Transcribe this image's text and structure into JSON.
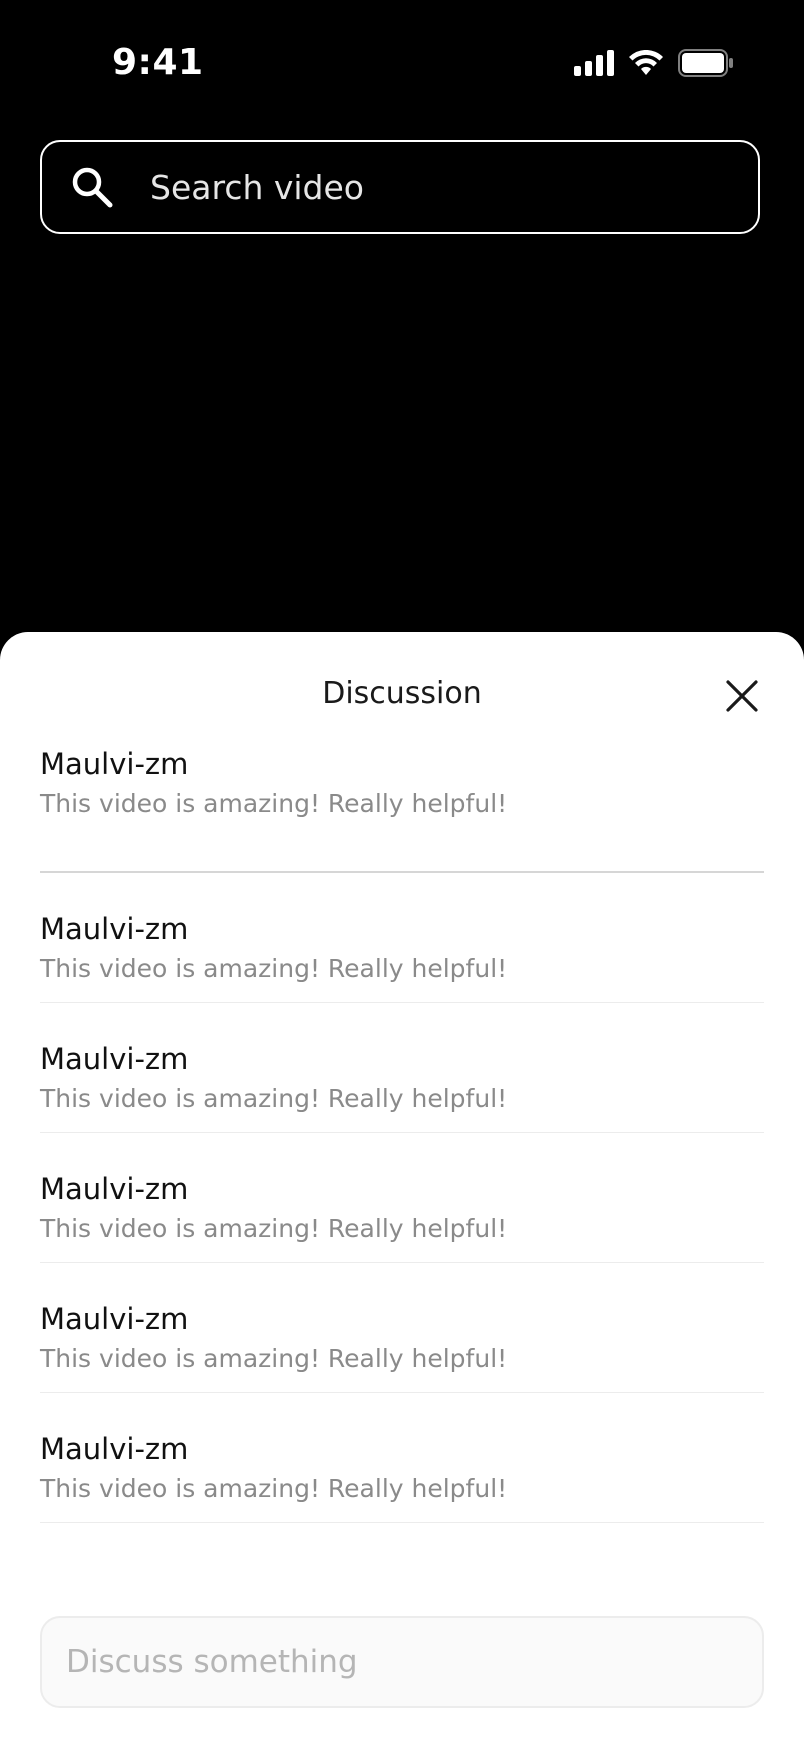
{
  "status_bar": {
    "time": "9:41",
    "icons": [
      "signal-icon",
      "wifi-icon",
      "battery-icon"
    ]
  },
  "search": {
    "placeholder": "Search video",
    "icon": "search-icon"
  },
  "discussion": {
    "title": "Discussion",
    "close_icon": "close-icon",
    "comments": [
      {
        "author": "Maulvi-zm",
        "text": "This video is amazing! Really helpful!"
      },
      {
        "author": "Maulvi-zm",
        "text": "This video is amazing! Really helpful!"
      },
      {
        "author": "Maulvi-zm",
        "text": "This video is amazing! Really helpful!"
      },
      {
        "author": "Maulvi-zm",
        "text": "This video is amazing! Really helpful!"
      },
      {
        "author": "Maulvi-zm",
        "text": "This video is amazing! Really helpful!"
      },
      {
        "author": "Maulvi-zm",
        "text": "This video is amazing! Really helpful!"
      }
    ],
    "input_placeholder": "Discuss something"
  },
  "colors": {
    "background": "#000000",
    "sheet": "#ffffff",
    "muted_text": "#8a8a8a"
  }
}
